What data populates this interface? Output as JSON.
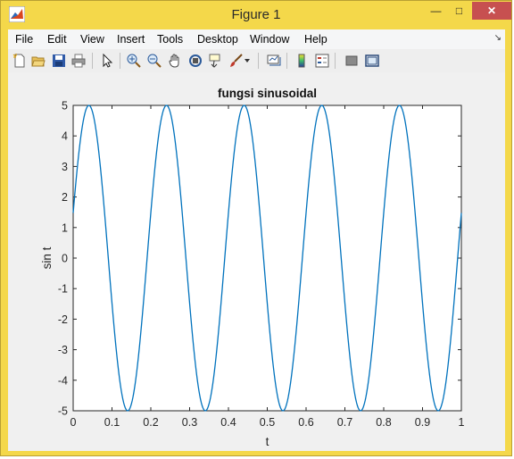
{
  "window": {
    "title": "Figure 1",
    "minimize": "—",
    "maximize": "□",
    "close": "✕"
  },
  "menu": {
    "items": [
      "File",
      "Edit",
      "View",
      "Insert",
      "Tools",
      "Desktop",
      "Window",
      "Help"
    ],
    "dock_icon": "dock-arrow-icon"
  },
  "toolbar": {
    "icons": [
      "new-figure-icon",
      "open-file-icon",
      "save-icon",
      "print-icon",
      "edit-plot-arrow-icon",
      "zoom-in-icon",
      "zoom-out-icon",
      "pan-hand-icon",
      "rotate-3d-icon",
      "data-cursor-icon",
      "brush-icon",
      "brush-dropdown-icon",
      "link-plot-icon",
      "colorbar-icon",
      "legend-icon",
      "hide-plot-tools-icon",
      "show-plot-tools-icon"
    ]
  },
  "colors": {
    "line": "#0072bd",
    "axes_bg": "#ffffff",
    "figure_bg": "#f0f0f0",
    "titlebar": "#f4d84a"
  },
  "chart_data": {
    "type": "line",
    "title": "fungsi sinusoidal",
    "xlabel": "t",
    "ylabel": "sin t",
    "xlim": [
      0,
      1
    ],
    "ylim": [
      -5,
      5
    ],
    "xticks": [
      "0",
      "0.1",
      "0.2",
      "0.3",
      "0.4",
      "0.5",
      "0.6",
      "0.7",
      "0.8",
      "0.9",
      "1"
    ],
    "yticks": [
      "5",
      "4",
      "3",
      "2",
      "1",
      "0",
      "-1",
      "-2",
      "-3",
      "-4",
      "-5"
    ],
    "grid": false,
    "series": [
      {
        "function": "5*sin(2*pi*5*t + 0.3)",
        "amplitude": 5,
        "frequency_hz": 5,
        "phase_rad": 0.3,
        "t_start": 0,
        "t_end": 1,
        "samples": 501
      }
    ]
  }
}
